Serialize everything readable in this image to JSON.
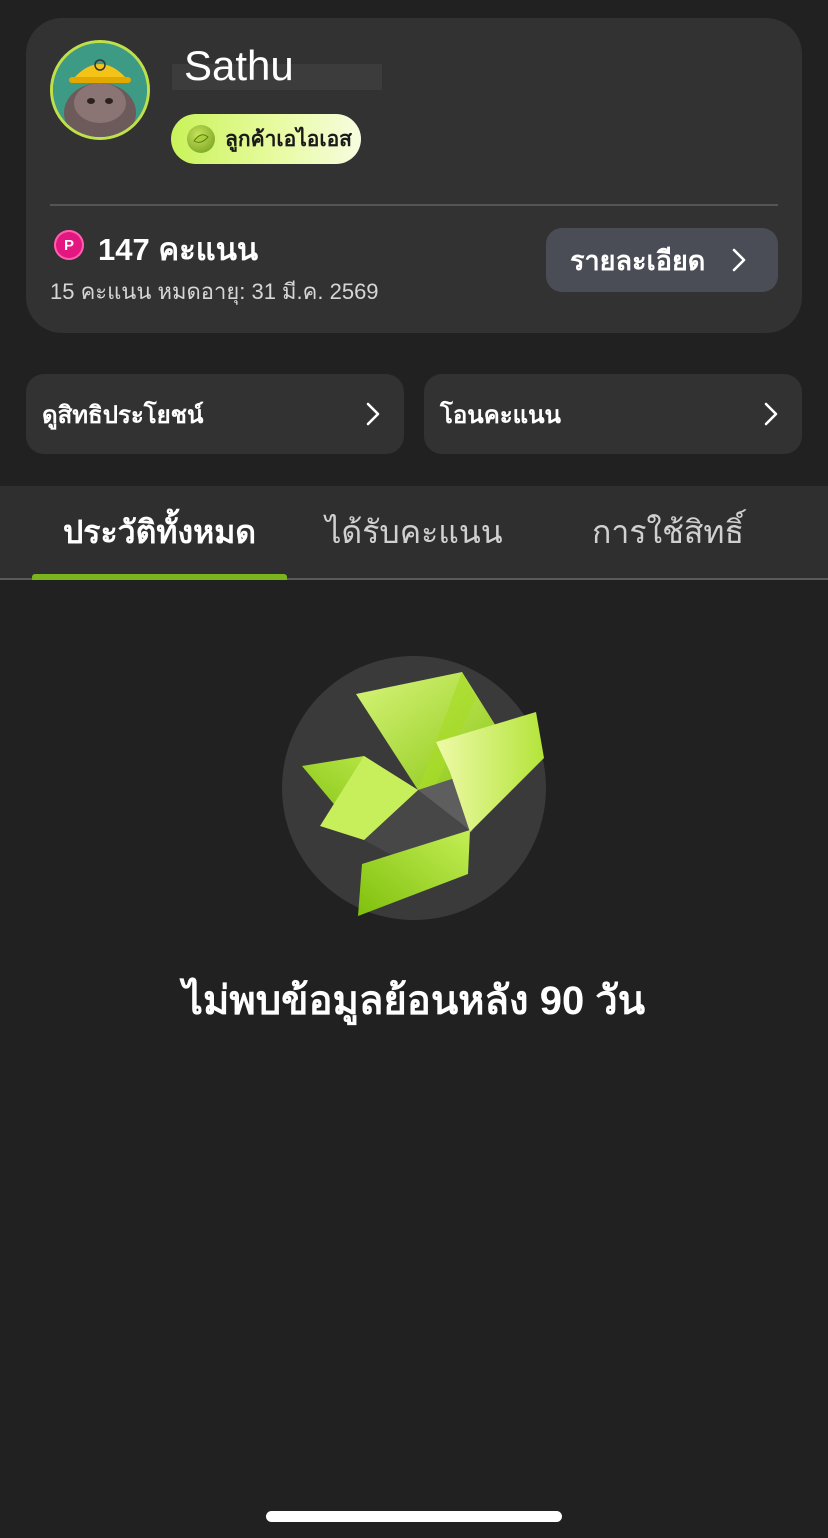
{
  "profile": {
    "name": "Sathu",
    "tier": "ลูกค้าเอไอเอส"
  },
  "points": {
    "icon_letter": "P",
    "value": "147 คะแนน",
    "expiry": "15 คะแนน  หมดอายุ: 31 มี.ค. 2569",
    "detail_button": "รายละเอียด"
  },
  "quick_actions": [
    {
      "label": "ดูสิทธิประโยชน์"
    },
    {
      "label": "โอนคะแนน"
    }
  ],
  "tabs": [
    {
      "label": "ประวัติทั้งหมด",
      "active": true
    },
    {
      "label": "ได้รับคะแนน",
      "active": false
    },
    {
      "label": "การใช้สิทธิ์",
      "active": false
    }
  ],
  "empty_state": {
    "message": "ไม่พบข้อมูลย้อนหลัง 90 วัน",
    "icon": "open-box-icon"
  },
  "colors": {
    "background": "#212121",
    "card": "#323232",
    "accent_green": "#7ab51d",
    "points_pink": "#e3177f",
    "detail_button": "#4a4d56"
  }
}
